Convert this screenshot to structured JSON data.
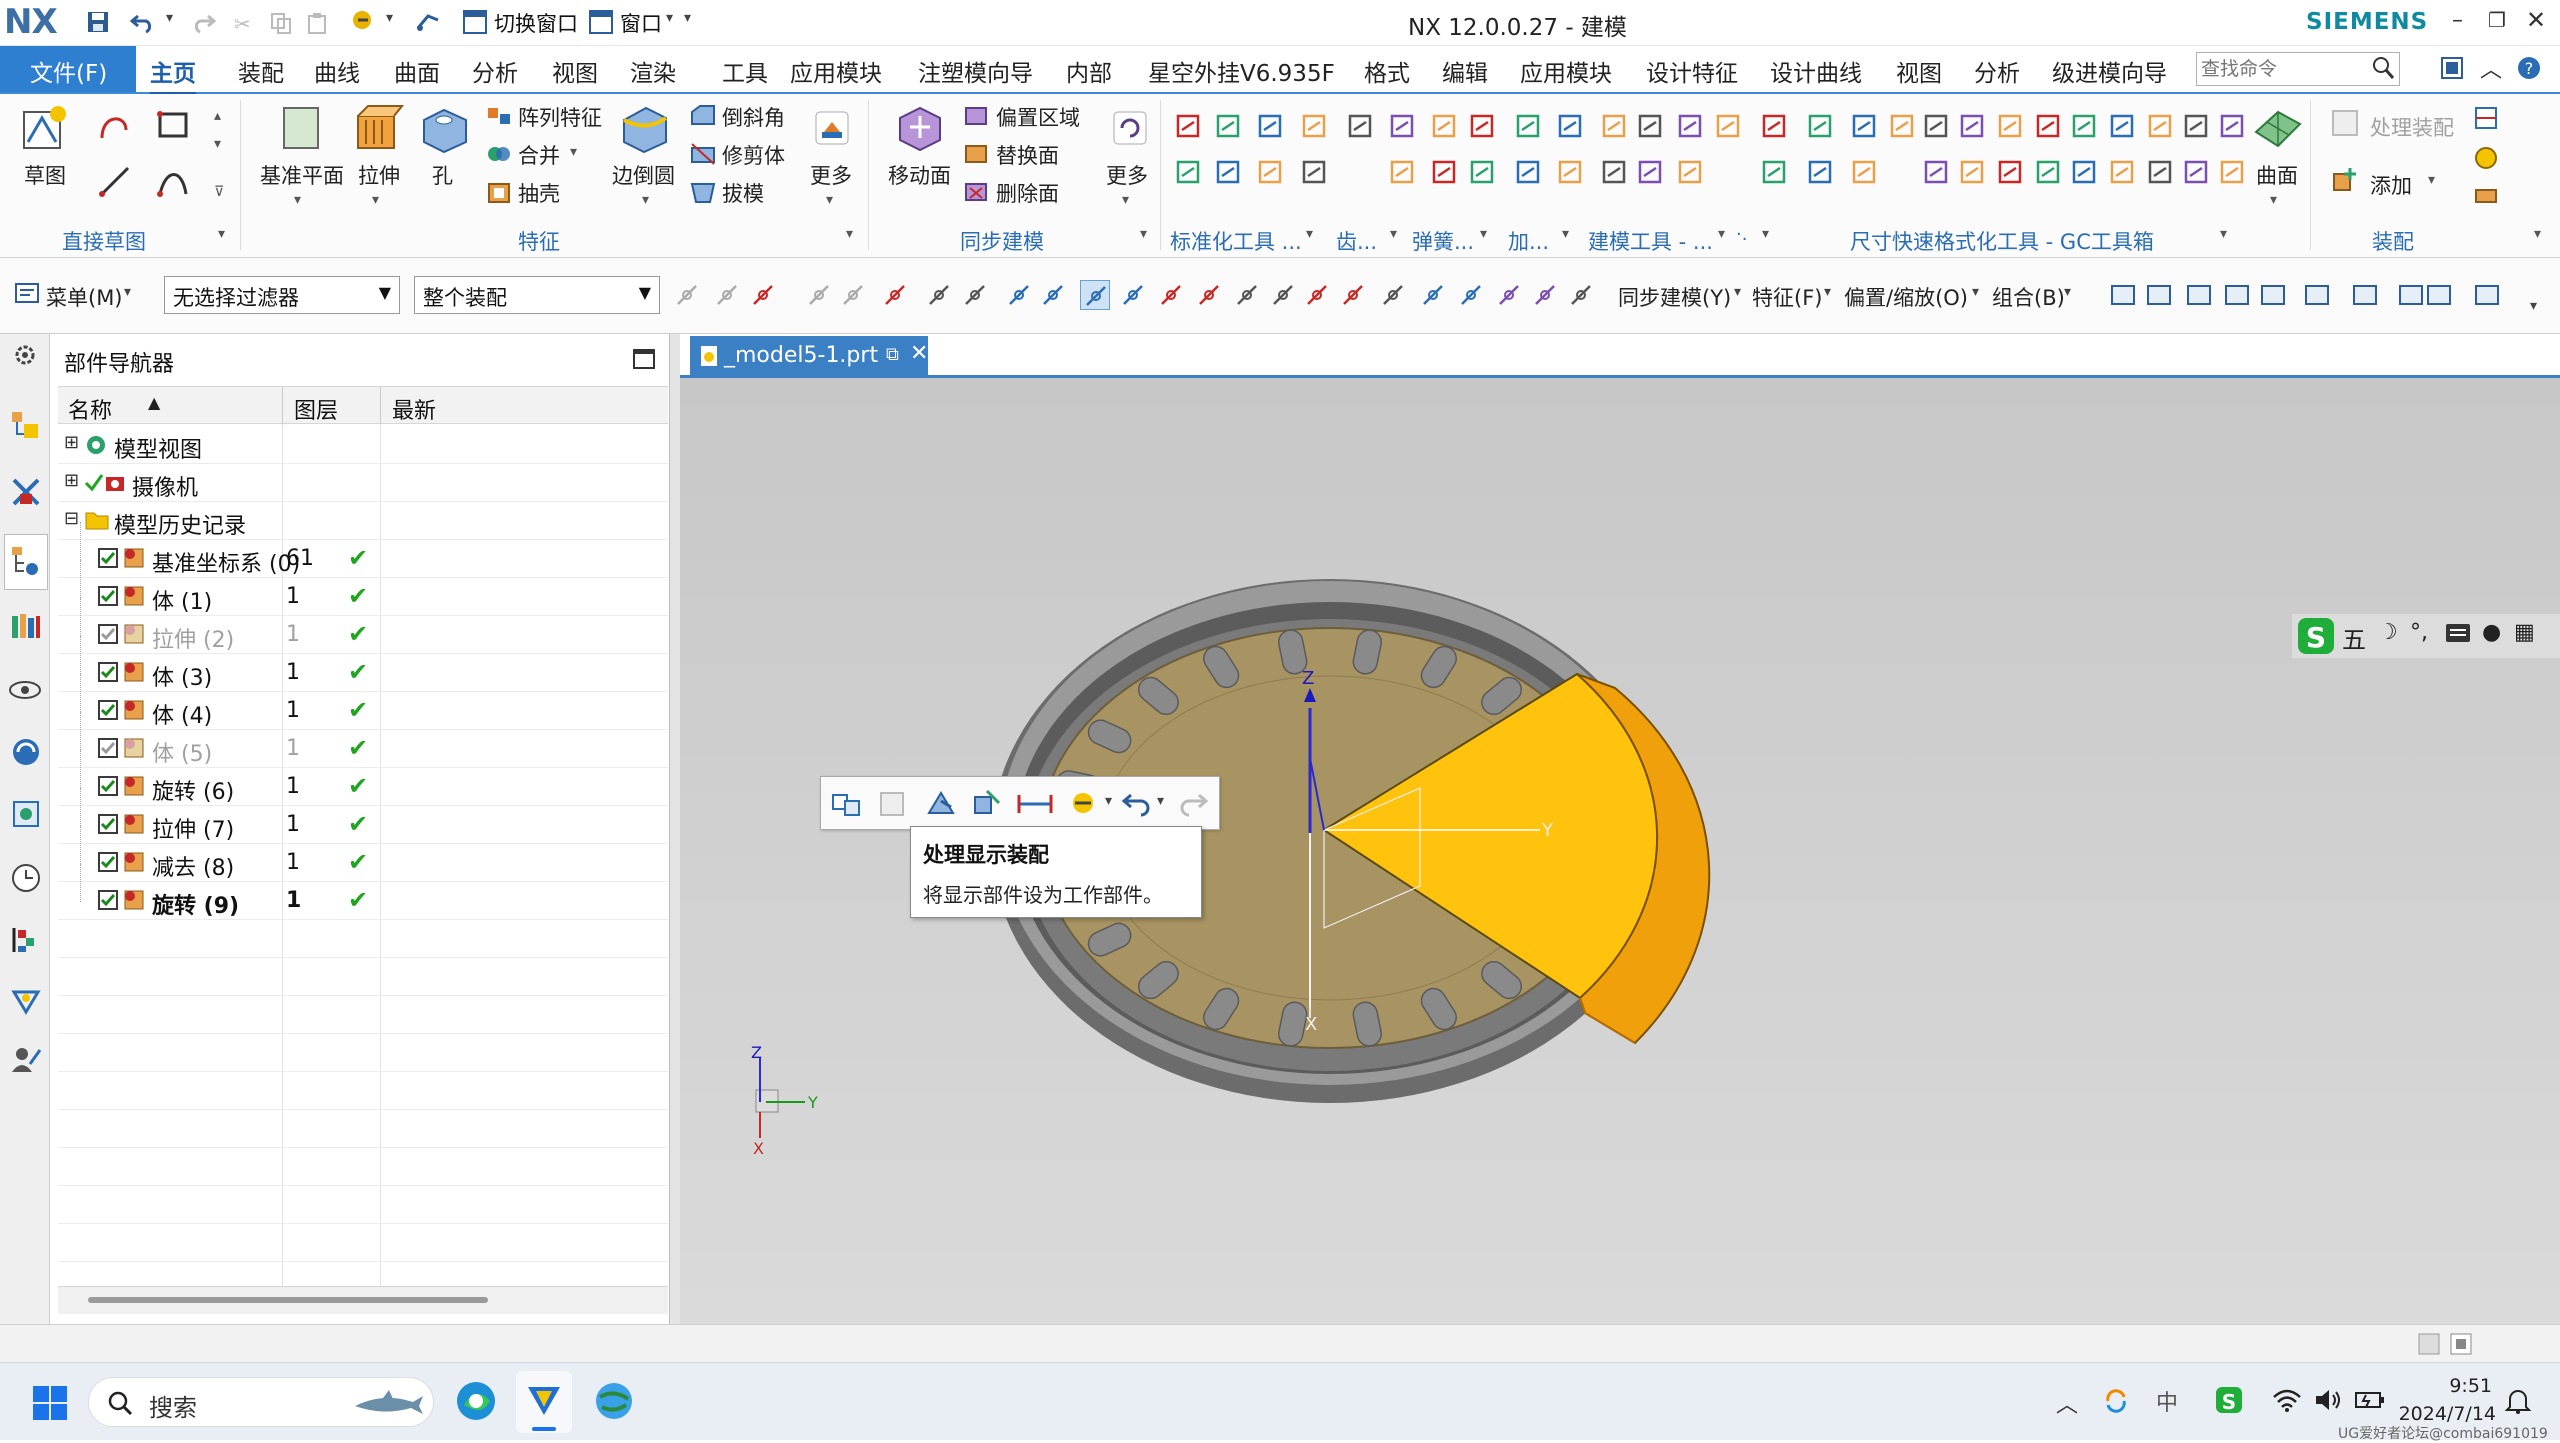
{
  "app": {
    "logo": "NX",
    "title": "NX 12.0.0.27 - 建模",
    "brand": "SIEMENS",
    "switch_window": "切换窗口",
    "window": "窗口"
  },
  "menu": {
    "file": "文件(F)",
    "tabs": [
      "主页",
      "装配",
      "曲线",
      "曲面",
      "分析",
      "视图",
      "渲染",
      "工具",
      "应用模块",
      "注塑模向导",
      "内部",
      "星空外挂V6.935F",
      "格式",
      "编辑",
      "应用模块",
      "设计特征",
      "设计曲线",
      "视图",
      "分析",
      "级进模向导"
    ],
    "search_placeholder": "查找命令"
  },
  "ribbon": {
    "sketch": "草图",
    "datum_plane": "基准平面",
    "extrude": "拉伸",
    "hole": "孔",
    "pattern_feature": "阵列特征",
    "unite": "合并",
    "shell": "抽壳",
    "edge_blend": "边倒圆",
    "chamfer": "倒斜角",
    "trim_body": "修剪体",
    "draft": "拔模",
    "more1": "更多",
    "move_face": "移动面",
    "offset_region": "偏置区域",
    "replace_face": "替换面",
    "delete_face": "删除面",
    "more2": "更多",
    "surface": "曲面",
    "process_feature": "处理装配",
    "add": "添加",
    "groups": {
      "direct_sketch": "直接草图",
      "feature": "特征",
      "sync_model": "同步建模",
      "std_tools": "标准化工具 ...",
      "gear": "齿...",
      "spring": "弹簧...",
      "add_short": "加...",
      "model_tools": "建模工具 - ...",
      "dim_format": "尺寸快速格式化工具 - GC工具箱",
      "assembly": "装配"
    }
  },
  "toolbar2": {
    "menu": "菜单(M)",
    "filter": "无选择过滤器",
    "scope": "整个装配",
    "sync": "同步建模(Y)",
    "feature": "特征(F)",
    "offset_scale": "偏置/缩放(O)",
    "combine": "组合(B)"
  },
  "navigator": {
    "title": "部件导航器",
    "columns": [
      "名称",
      "图层",
      "最新"
    ],
    "tree": [
      {
        "label": "模型视图",
        "layer": "",
        "latest": false
      },
      {
        "label": "摄像机",
        "layer": "",
        "latest": false
      },
      {
        "label": "模型历史记录",
        "layer": "",
        "latest": false
      },
      {
        "label": "基准坐标系 (0)",
        "layer": "61",
        "latest": true
      },
      {
        "label": "体 (1)",
        "layer": "1",
        "latest": true
      },
      {
        "label": "拉伸 (2)",
        "layer": "1",
        "latest": true
      },
      {
        "label": "体 (3)",
        "layer": "1",
        "latest": true
      },
      {
        "label": "体 (4)",
        "layer": "1",
        "latest": true
      },
      {
        "label": "体 (5)",
        "layer": "1",
        "latest": true
      },
      {
        "label": "旋转 (6)",
        "layer": "1",
        "latest": true
      },
      {
        "label": "拉伸 (7)",
        "layer": "1",
        "latest": true
      },
      {
        "label": "减去 (8)",
        "layer": "1",
        "latest": true
      },
      {
        "label": "旋转 (9)",
        "layer": "1",
        "latest": true
      }
    ]
  },
  "viewport": {
    "tab": "_model5-1.prt",
    "tooltip_title": "处理显示装配",
    "tooltip_body": "将显示部件设为工作部件。",
    "axis_x": "X",
    "axis_y": "Y",
    "axis_z": "Z",
    "ime": "五"
  },
  "taskbar": {
    "search": "搜索",
    "time": "9:51",
    "date": "2024/7/14",
    "watermark": "UG爱好者论坛@combai691019"
  },
  "colors": {
    "accent": "#3a8ad6",
    "file_tab": "#2f7fd0",
    "gear_face": "#a89462",
    "cut_face": "#ffc20d",
    "cut_side": "#f0a00a",
    "check": "#1ea61e"
  }
}
